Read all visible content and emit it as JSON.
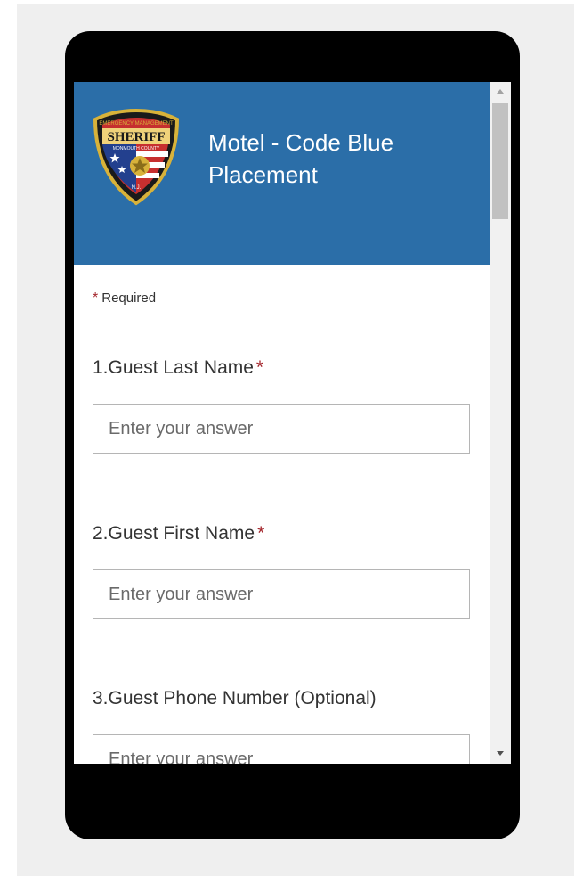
{
  "form": {
    "title": "Motel - Code Blue Placement",
    "required_note": "Required",
    "required_star": "*",
    "logo": {
      "icon": "sheriff-badge-icon",
      "text_top": "EMERGENCY MANAGEMENT",
      "text_main": "SHERIFF",
      "text_county": "MONMOUTH COUNTY",
      "text_bottom": "N.J."
    },
    "questions": [
      {
        "number": "1.",
        "label": "Guest Last Name",
        "required": "*",
        "placeholder": "Enter your answer"
      },
      {
        "number": "2.",
        "label": "Guest First Name",
        "required": "*",
        "placeholder": "Enter your answer"
      },
      {
        "number": "3.",
        "label": "Guest Phone Number (Optional)",
        "placeholder": "Enter your answer"
      }
    ]
  },
  "colors": {
    "header": "#2b6ea8",
    "required_star": "#a4262c",
    "phone_frame": "#000000",
    "outer_background": "#efefef"
  }
}
